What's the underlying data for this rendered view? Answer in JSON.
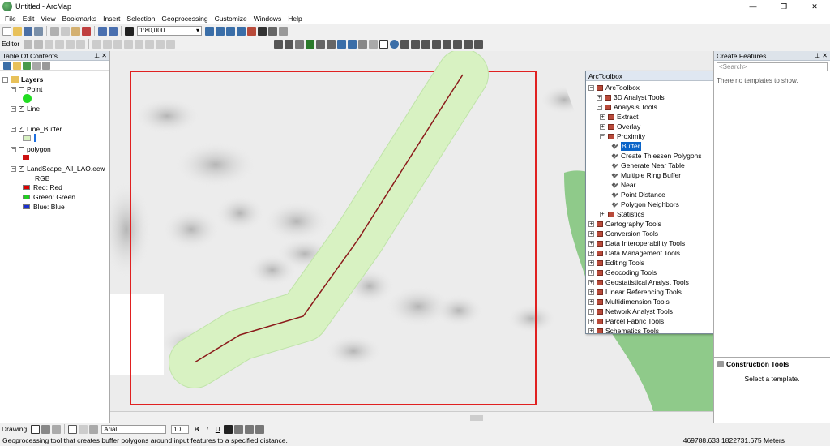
{
  "window": {
    "title": "Untitled - ArcMap"
  },
  "menu": [
    "File",
    "Edit",
    "View",
    "Bookmarks",
    "Insert",
    "Selection",
    "Geoprocessing",
    "Customize",
    "Windows",
    "Help"
  ],
  "toolbar": {
    "scale": "1:80,000",
    "editor_label": "Editor"
  },
  "toc": {
    "title": "Table Of Contents",
    "layers_label": "Layers",
    "items": {
      "point": "Point",
      "line": "Line",
      "line_buffer": "Line_Buffer",
      "polygon": "polygon",
      "raster": "LandScape_All_LAO.ecw",
      "rgb": "RGB",
      "red": "Red:   Red",
      "green": "Green: Green",
      "blue": "Blue:   Blue"
    }
  },
  "create_features": {
    "title": "Create Features",
    "search_placeholder": "<Search>",
    "empty_msg": "There no templates to show.",
    "construction_title": "Construction Tools",
    "construction_msg": "Select a template."
  },
  "arctoolbox": {
    "title": "ArcToolbox",
    "items": [
      "ArcToolbox",
      "3D Analyst Tools",
      "Analysis Tools",
      "Extract",
      "Overlay",
      "Proximity",
      "Buffer",
      "Create Thiessen Polygons",
      "Generate Near Table",
      "Multiple Ring Buffer",
      "Near",
      "Point Distance",
      "Polygon Neighbors",
      "Statistics",
      "Cartography Tools",
      "Conversion Tools",
      "Data Interoperability Tools",
      "Data Management Tools",
      "Editing Tools",
      "Geocoding Tools",
      "Geostatistical Analyst Tools",
      "Linear Referencing Tools",
      "Multidimension Tools",
      "Network Analyst Tools",
      "Parcel Fabric Tools",
      "Schematics Tools"
    ]
  },
  "drawing_toolbar": {
    "label": "Drawing",
    "font": "Arial",
    "size": "10"
  },
  "status": {
    "message": "Geoprocessing tool that creates buffer polygons around input features to a specified distance.",
    "coords": "469788.633  1822731.675 Meters"
  },
  "colors": {
    "point_symbol": "#22dd22",
    "line_symbol": "#8b1a1a",
    "buffer_fill": "#d8f2c2",
    "extent_outline": "#e02020",
    "forest": "#8fca8a",
    "selection": "#0a64c8"
  }
}
